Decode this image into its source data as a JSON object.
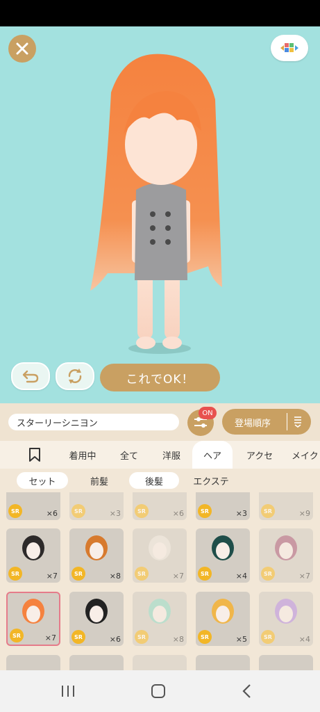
{
  "stage": {
    "ok_label": "これでOK！"
  },
  "toolbar": {
    "item_name": "スターリーシニヨン",
    "filter_badge": "ON",
    "sort_label": "登場順序"
  },
  "tabs": [
    {
      "label": "着用中"
    },
    {
      "label": "全て"
    },
    {
      "label": "洋服"
    },
    {
      "label": "ヘア"
    },
    {
      "label": "アクセ"
    },
    {
      "label": "メイク"
    }
  ],
  "subtabs": [
    {
      "label": "セット"
    },
    {
      "label": "前髪"
    },
    {
      "label": "後髪"
    },
    {
      "label": "エクステ"
    }
  ],
  "grid": {
    "rarity": "SR",
    "row1_counts": [
      "×6",
      "×3",
      "×6",
      "×3",
      "×9"
    ],
    "row2_counts": [
      "×7",
      "×8",
      "×7",
      "×4",
      "×7"
    ],
    "row3_counts": [
      "×7",
      "×6",
      "×8",
      "×5",
      "×4"
    ]
  },
  "colors": {
    "stage_bg": "#a3e1df",
    "accent_gold": "#c9a062",
    "hair_orange": "#f5823f",
    "badge_red": "#e8514e",
    "sr_yellow": "#f2b626"
  }
}
